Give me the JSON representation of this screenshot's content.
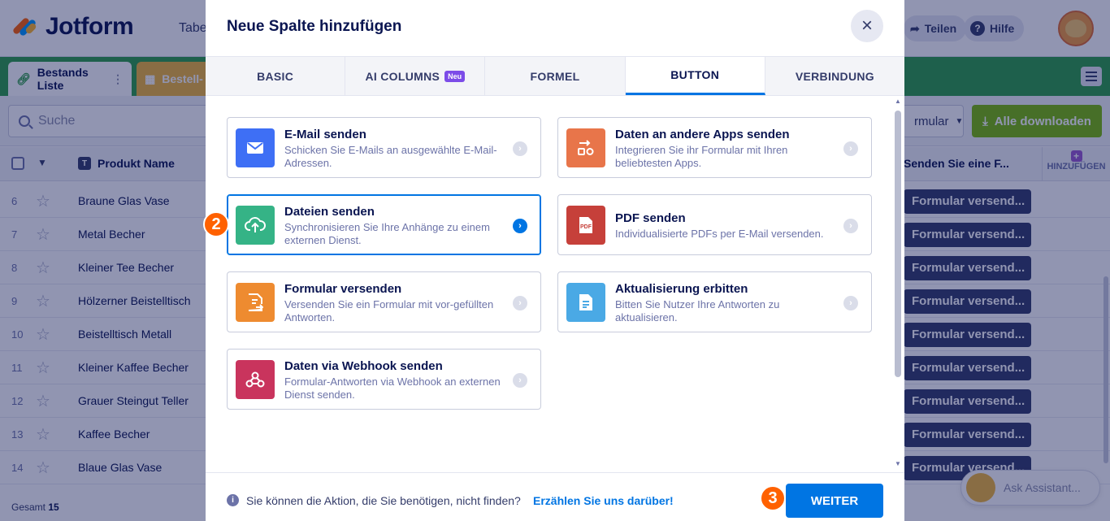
{
  "app": {
    "logo_text": "Jotform",
    "breadcrumb": "Tabe",
    "share_label": "Teilen",
    "help_label": "Hilfe"
  },
  "sheet_tabs": [
    {
      "label": "Bestands Liste"
    },
    {
      "label": "Bestell-"
    }
  ],
  "toolbar": {
    "search_placeholder": "Suche",
    "form_select_value": "rmular",
    "download_label": "Alle downloaden"
  },
  "grid": {
    "column_product": "Produkt Name",
    "column_send": "Senden Sie eine F...",
    "add_column_label": "HINZUFÜGEN",
    "rows": [
      {
        "num": "6",
        "name": "Braune Glas Vase",
        "action": "Formular versend..."
      },
      {
        "num": "7",
        "name": "Metal Becher",
        "action": "Formular versend..."
      },
      {
        "num": "8",
        "name": "Kleiner Tee Becher",
        "action": "Formular versend..."
      },
      {
        "num": "9",
        "name": "Hölzerner Beistelltisch",
        "action": "Formular versend..."
      },
      {
        "num": "10",
        "name": "Beistelltisch Metall",
        "action": "Formular versend..."
      },
      {
        "num": "11",
        "name": "Kleiner Kaffee Becher",
        "action": "Formular versend..."
      },
      {
        "num": "12",
        "name": "Grauer Steingut Teller",
        "action": "Formular versend..."
      },
      {
        "num": "13",
        "name": "Kaffee Becher",
        "action": "Formular versend..."
      },
      {
        "num": "14",
        "name": "Blaue Glas Vase",
        "action": "Formular versend..."
      }
    ],
    "total_label": "Gesamt",
    "total_value": "15"
  },
  "assistant_label": "Ask Assistant...",
  "modal": {
    "title": "Neue Spalte hinzufügen",
    "tabs": [
      {
        "label": "BASIC",
        "badge": ""
      },
      {
        "label": "AI COLUMNS",
        "badge": "Neu"
      },
      {
        "label": "FORMEL",
        "badge": ""
      },
      {
        "label": "BUTTON",
        "badge": ""
      },
      {
        "label": "VERBINDUNG",
        "badge": ""
      }
    ],
    "active_tab": "BUTTON",
    "cards": [
      {
        "title": "E-Mail senden",
        "desc": "Schicken Sie E-Mails an ausgewählte E-Mail-Adressen.",
        "icon": "envelope-icon",
        "color": "#3e6ff5"
      },
      {
        "title": "Daten an andere Apps senden",
        "desc": "Integrieren Sie ihr Formular mit Ihren beliebtesten Apps.",
        "icon": "apps-icon",
        "color": "#e8754a"
      },
      {
        "title": "Dateien senden",
        "desc": "Synchronisieren Sie Ihre Anhänge zu einem externen Dienst.",
        "icon": "cloud-upload-icon",
        "color": "#35b386"
      },
      {
        "title": "PDF senden",
        "desc": "Individualisierte PDFs per E-Mail versenden.",
        "icon": "pdf-icon",
        "color": "#c6403a"
      },
      {
        "title": "Formular versenden",
        "desc": "Versenden Sie ein Formular mit vor-gefüllten Antworten.",
        "icon": "form-send-icon",
        "color": "#ee8b30"
      },
      {
        "title": "Aktualisierung erbitten",
        "desc": "Bitten Sie Nutzer Ihre Antworten zu aktualisieren.",
        "icon": "document-icon",
        "color": "#4aa9e5"
      },
      {
        "title": "Daten via Webhook senden",
        "desc": "Formular-Antworten via Webhook an externen Dienst senden.",
        "icon": "webhook-icon",
        "color": "#c9345d"
      }
    ],
    "selected_card": "Dateien senden",
    "step_markers": [
      "2",
      "3"
    ],
    "footer_info": "Sie können die Aktion, die Sie benötigen, nicht finden?",
    "footer_link": "Erzählen Sie uns darüber!",
    "next_label": "WEITER",
    "pdf_glyph": "PDF"
  }
}
